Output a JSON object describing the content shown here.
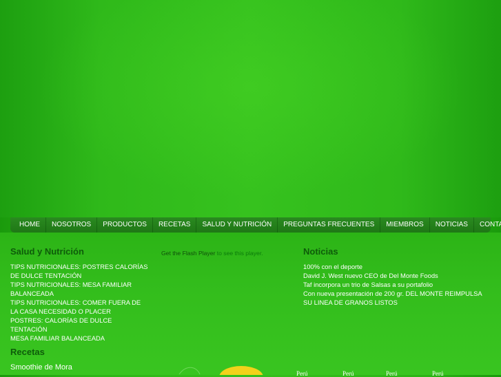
{
  "nav": {
    "items": [
      {
        "label": "HOME"
      },
      {
        "label": "NOSOTROS"
      },
      {
        "label": "PRODUCTOS"
      },
      {
        "label": "RECETAS"
      },
      {
        "label": "SALUD Y NUTRICIÓN"
      },
      {
        "label": "PREGUNTAS FRECUENTES"
      },
      {
        "label": "MIEMBROS"
      },
      {
        "label": "NOTICIAS"
      },
      {
        "label": "CONTACTO"
      }
    ]
  },
  "salud": {
    "title": "Salud y Nutrición",
    "items": [
      "TIPS NUTRICIONALES: POSTRES CALORÍAS DE DULCE TENTACIÓN",
      "TIPS NUTRICIONALES: MESA FAMILIAR BALANCEADA",
      "TIPS NUTRICIONALES: COMER FUERA DE LA CASA NECESIDAD O PLACER",
      "POSTRES: CALORÍAS DE DULCE TENTACIÓN",
      "MESA FAMILIAR BALANCEADA"
    ]
  },
  "flash": {
    "link_text": "Get the Flash Player",
    "rest_text": " to see this player."
  },
  "noticias": {
    "title": "Noticias",
    "items": [
      "100% con el deporte",
      "David J. West nuevo CEO de Del Monte Foods",
      "Taf incorpora un trio de Salsas a su portafolio",
      "Con nueva presentación de 200 gr. DEL MONTE REIMPULSA SU LINEA DE GRANOS LISTOS"
    ]
  },
  "recetas": {
    "title": "Recetas",
    "first_item": "Smoothie de Mora"
  },
  "bottom": {
    "labels": [
      "Perú",
      "Perú",
      "Perú",
      "Perú"
    ]
  },
  "colors": {
    "background": "#33bd1c",
    "nav": "#1f7716",
    "section_title": "#0e5c0a"
  }
}
